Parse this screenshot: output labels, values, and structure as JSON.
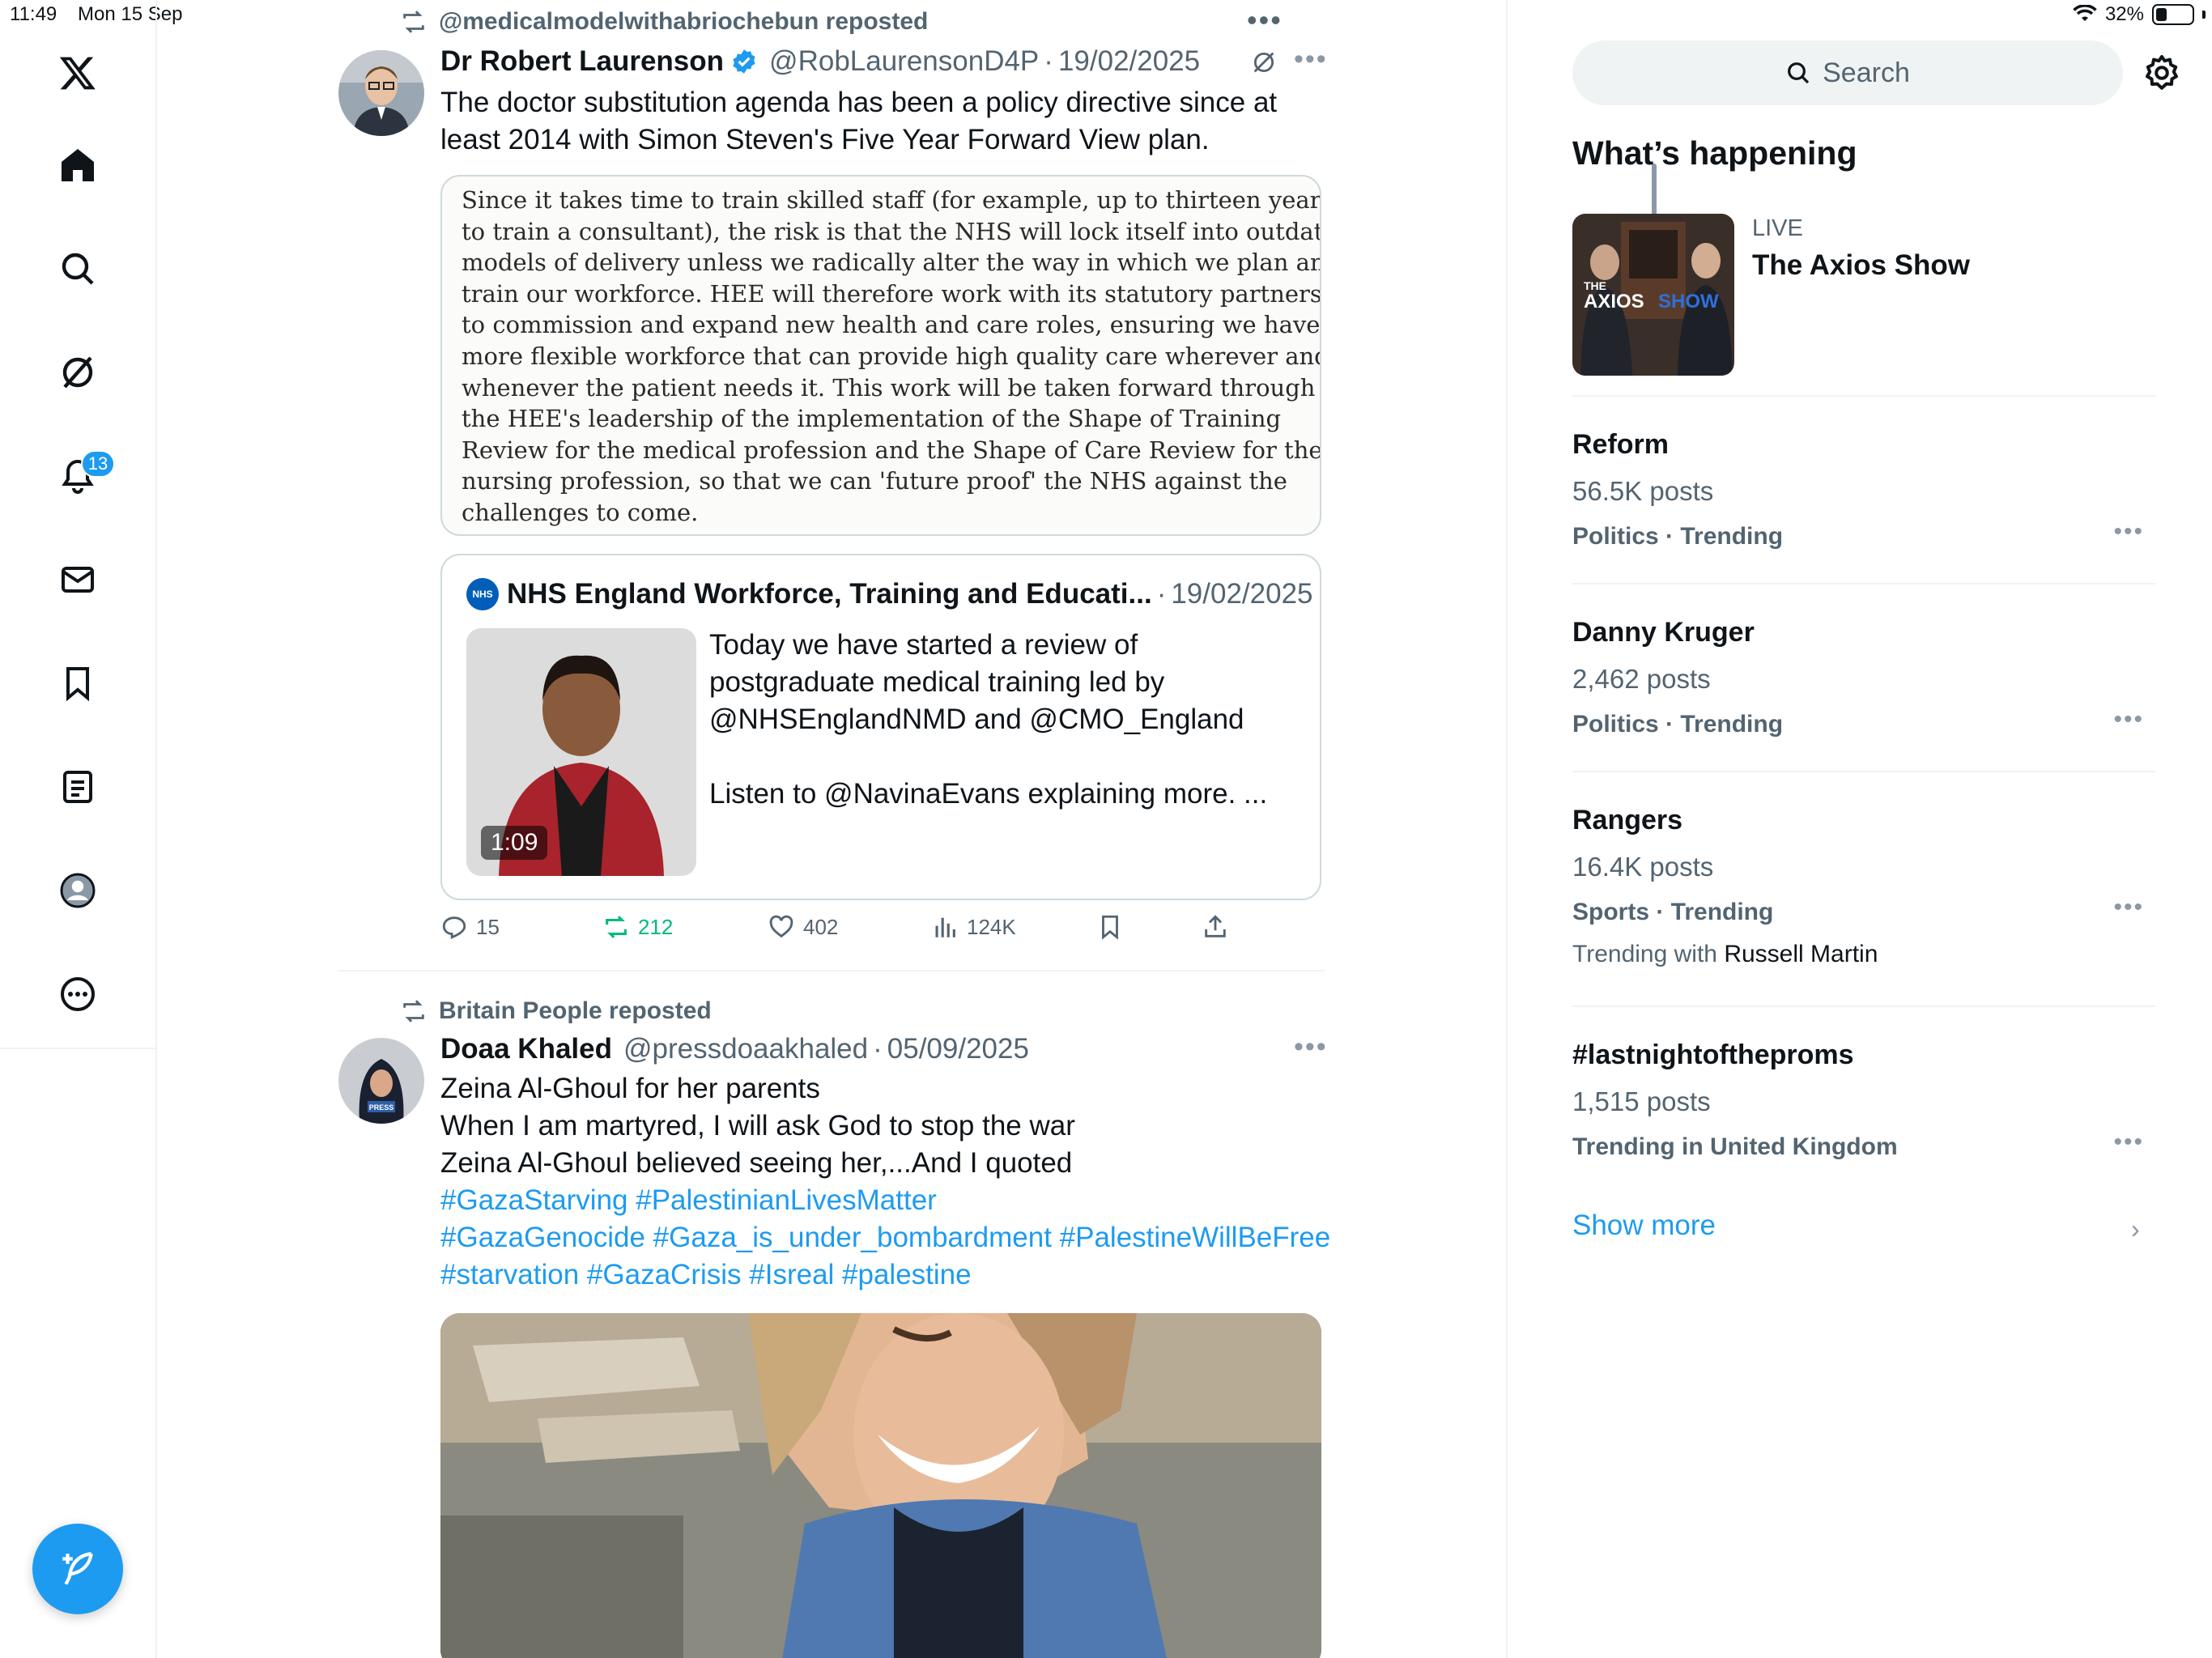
{
  "status_bar": {
    "time": "11:49",
    "date": "Mon 15 Sep",
    "battery": "32%",
    "battery_level": 0.32
  },
  "nav": {
    "items": [
      {
        "icon": "x-logo"
      },
      {
        "icon": "home-icon"
      },
      {
        "icon": "search-icon"
      },
      {
        "icon": "grok-icon"
      },
      {
        "icon": "bell-icon"
      },
      {
        "icon": "mail-icon"
      },
      {
        "icon": "bookmark-icon"
      },
      {
        "icon": "list-icon"
      },
      {
        "icon": "profile-icon"
      },
      {
        "icon": "more-circle-icon"
      }
    ],
    "notification_badge": "13",
    "compose_icon": "compose-icon"
  },
  "feed": {
    "tweet1": {
      "repost_by": "@medicalmodelwithabriochebun reposted",
      "name": "Dr Robert Laurenson",
      "handle": "@RobLaurensonD4P",
      "sep": "·",
      "date": "19/02/2025",
      "text_lines": [
        "The doctor substitution agenda has been a policy directive since at",
        "least 2014 with Simon Steven's Five Year Forward View plan."
      ],
      "doc_lines": [
        "Since it takes time to train skilled staff (for example, up to thirteen years",
        "to train a consultant), the risk is that the NHS will lock itself into outdated",
        "models of delivery unless we radically alter the way in which we plan and",
        "train our workforce. HEE will therefore work with its statutory partners",
        "to commission and expand new health and care roles, ensuring we have a",
        "more flexible workforce that can provide high quality care wherever and",
        "whenever the patient needs it. This work will be taken forward through",
        "the HEE's leadership of the implementation of the Shape of Training",
        "Review for the medical profession and the Shape of Care Review for the",
        "nursing profession, so that we can 'future proof' the NHS against the",
        "challenges to come."
      ],
      "quote": {
        "logo": "NHS",
        "name": "NHS England Workforce, Training and Educati...",
        "sep": "·",
        "date": "19/02/2025",
        "duration": "1:09",
        "text_lines": [
          "Today we have started a review of",
          "postgraduate medical training led by",
          "@NHSEnglandNMD and @CMO_England",
          "",
          "Listen to @NavinaEvans explaining more. ..."
        ]
      },
      "actions": {
        "replies": "15",
        "reposts": "212",
        "likes": "402",
        "views": "124K"
      }
    },
    "tweet2": {
      "repost_by": "Britain People reposted",
      "name": "Doaa Khaled",
      "handle": "@pressdoaakhaled",
      "sep": "·",
      "date": "05/09/2025",
      "text_lines": [
        "Zeina Al-Ghoul for her parents",
        "When I am martyred, I will ask God to stop the war",
        "Zeina Al-Ghoul believed seeing her,...And I quoted"
      ],
      "hashtag_lines": [
        "#GazaStarving #PalestinianLivesMatter",
        "#GazaGenocide #Gaza_is_under_bombardment #PalestineWillBeFree",
        "#starvation #GazaCrisis #Isreal #palestine"
      ],
      "avatar_text": "PRESS"
    }
  },
  "sidebar": {
    "search_placeholder": "Search",
    "title": "What’s happening",
    "live": {
      "tag": "LIVE",
      "title": "The Axios Show",
      "thumb_text_1": "THE",
      "thumb_text_2": "AXIOS",
      "thumb_text_3": "SHOW"
    },
    "trends": [
      {
        "name": "Reform",
        "count": "56.5K posts",
        "category": "Politics · Trending"
      },
      {
        "name": "Danny Kruger",
        "count": "2,462 posts",
        "category": "Politics · Trending"
      },
      {
        "name": "Rangers",
        "count": "16.4K posts",
        "category": "Sports · Trending",
        "with_prefix": "Trending with",
        "with_name": "Russell Martin"
      },
      {
        "name": "#lastnightoftheproms",
        "count": "1,515 posts",
        "category": "Trending in United Kingdom"
      }
    ],
    "show_more": "Show more",
    "chevron": "›"
  },
  "colors": {
    "accent": "#1d9bf0",
    "repost_green": "#00ba7c",
    "muted": "#536471",
    "border": "#eff3f4"
  }
}
